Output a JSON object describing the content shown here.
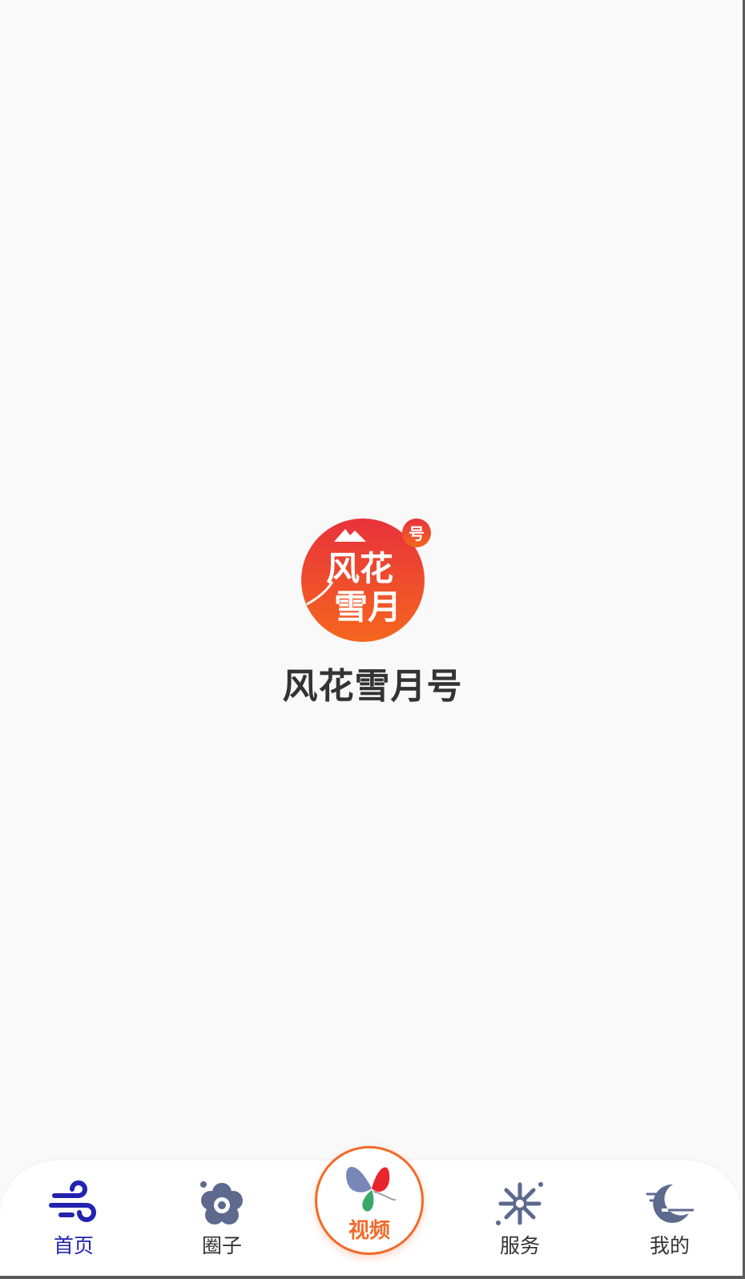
{
  "splash": {
    "logo_name": "fenghuaxueyue-logo",
    "logo_small_text": "号",
    "logo_main_text_1": "风花",
    "logo_main_text_2": "雪月",
    "app_name": "风花雪月号"
  },
  "tabbar": {
    "tabs": [
      {
        "label": "首页",
        "icon": "wind-icon",
        "active": true
      },
      {
        "label": "圈子",
        "icon": "flower-icon",
        "active": false
      },
      {
        "label": "视频",
        "icon": "butterfly-icon",
        "active": false
      },
      {
        "label": "服务",
        "icon": "snowflake-icon",
        "active": false
      },
      {
        "label": "我的",
        "icon": "moon-icon",
        "active": false
      }
    ]
  },
  "colors": {
    "background": "#f9f9f9",
    "active_tab": "#2323b0",
    "accent": "#f26a2a",
    "icon_gray": "#5d6a8e",
    "logo_gradient_top": "#e8323c",
    "logo_gradient_bottom": "#f5661e"
  }
}
